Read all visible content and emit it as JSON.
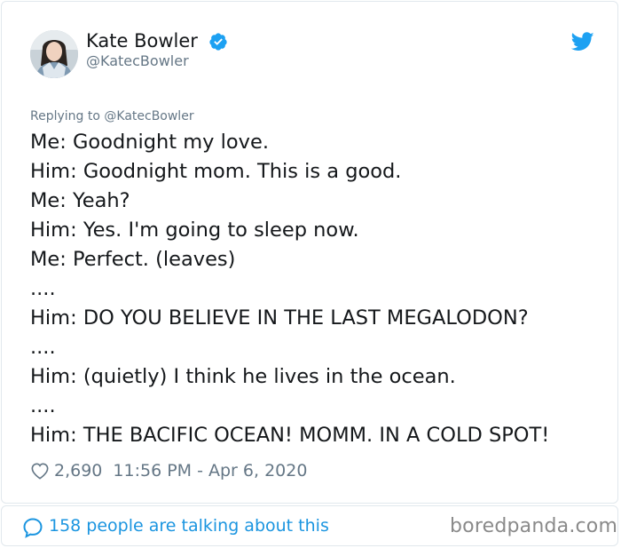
{
  "tweet": {
    "author": {
      "display_name": "Kate Bowler",
      "handle": "@KatecBowler",
      "verified": true,
      "verified_icon": "verified-badge-icon",
      "avatar_icon": "avatar"
    },
    "platform_icon": "twitter-bird-icon",
    "replying_to": "Replying to @KatecBowler",
    "lines": [
      "Me: Goodnight my love.",
      "Him: Goodnight mom. This is a good.",
      "Me: Yeah?",
      "Him: Yes. I'm going to sleep now.",
      "Me: Perfect. (leaves)",
      "....",
      "Him: DO YOU BELIEVE IN THE LAST MEGALODON?",
      "....",
      "Him: (quietly) I think he lives in the ocean.",
      "....",
      "Him: THE BACIFIC OCEAN! MOMM. IN A COLD SPOT!"
    ],
    "likes": "2,690",
    "timestamp": "11:56 PM - Apr 6, 2020"
  },
  "footer": {
    "talking": "158 people are talking about this",
    "watermark": "boredpanda.com"
  },
  "colors": {
    "text": "#14171a",
    "secondary": "#657786",
    "accent": "#1da1f2",
    "link": "#1b95e0",
    "border": "#e1e8ed"
  }
}
